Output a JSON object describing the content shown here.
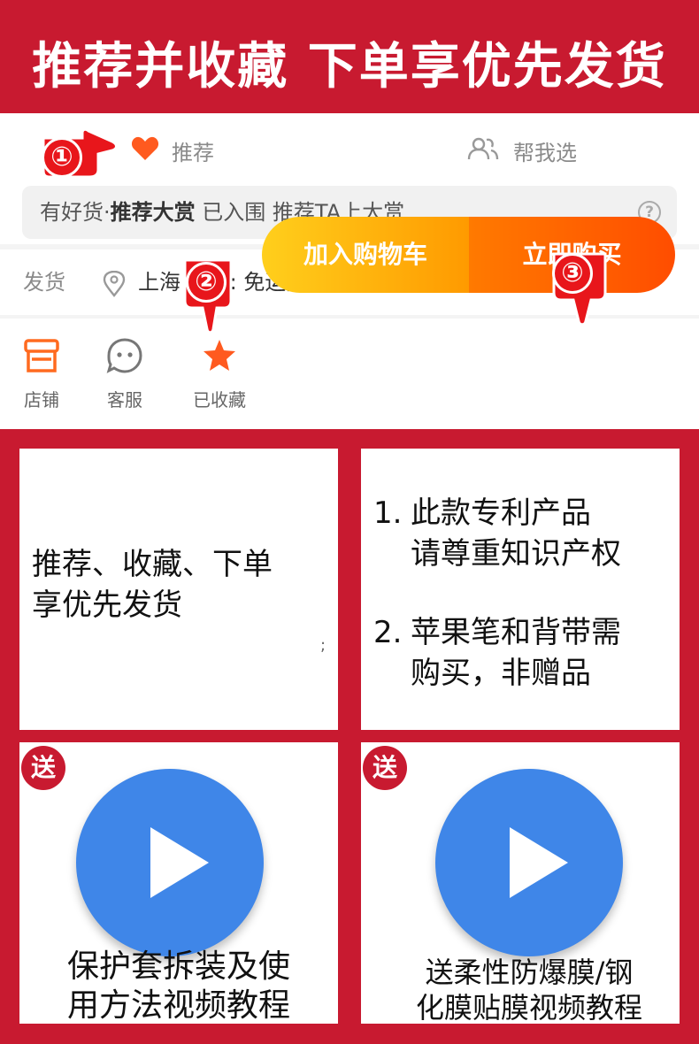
{
  "banner": {
    "title": "推荐并收藏  下单享优先发货"
  },
  "app": {
    "recommend_tab": "推荐",
    "help_tab": "帮我选",
    "award": {
      "prefix": "有好货·",
      "bold": "推荐大赏",
      "suffix": " 已入围 推荐TA上大赏",
      "help_icon": "?"
    },
    "shipping": {
      "label": "发货",
      "text": "上海   快递: 免运费"
    },
    "bottom_bar": {
      "shop": "店铺",
      "service": "客服",
      "favorited": "已收藏",
      "add_to_cart": "加入购物车",
      "buy_now": "立即购买"
    },
    "steps": [
      "①",
      "②",
      "③"
    ]
  },
  "cards": {
    "promo": {
      "line1": "推荐、收藏、下单",
      "line2": "享优先发货",
      "mark": ";"
    },
    "notice": {
      "items": [
        {
          "num": "1.",
          "line1": "此款专利产品",
          "line2": "请尊重知识产权"
        },
        {
          "num": "2.",
          "line1": "苹果笔和背带需",
          "line2": "购买，非赠品"
        }
      ]
    },
    "video1": {
      "badge": "送",
      "line1": "保护套拆装及使",
      "line2": "用方法视频教程"
    },
    "video2": {
      "badge": "送",
      "line1": "送柔性防爆膜/钢",
      "line2": "化膜贴膜视频教程"
    }
  },
  "colors": {
    "brand_red": "#c81a30",
    "orange": "#ff5a1f",
    "cart_yellow": "#ffcf1c",
    "buy_orange": "#ff6a00",
    "play_blue": "#3f86e8"
  }
}
